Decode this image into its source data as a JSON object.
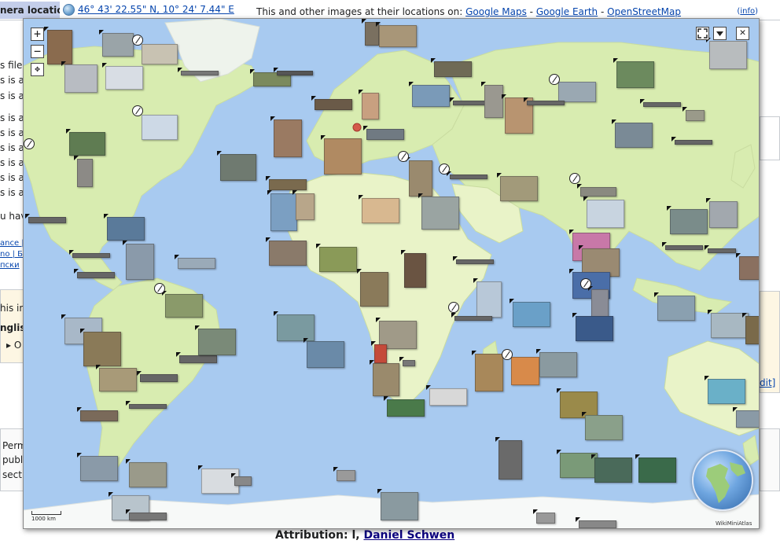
{
  "location_bar": {
    "label": "nera location",
    "coordinates": "46° 43' 22.55\" N, 10° 24' 7.44\" E",
    "text": "This and other images at their locations on:",
    "google_maps": "Google Maps",
    "google_earth": "Google Earth",
    "openstreetmap": "OpenStreetMap",
    "sep": "-",
    "info": "info"
  },
  "background": {
    "lines": [
      "s file w",
      "s is a",
      "s is a",
      "s is a",
      "s is a",
      "s is a",
      "s is a",
      "s is a",
      "s is a",
      "u hav"
    ],
    "links": [
      "ance | Б",
      "no | Б",
      "пски"
    ],
    "this_in": "his in",
    "english": "nglis",
    "o_item": "O",
    "perm_lines": [
      "Perm",
      "publi",
      "sect"
    ],
    "edit": "dit]"
  },
  "map": {
    "zoom_in": "+",
    "zoom_out": "−",
    "pan": "✥",
    "fullscreen_icon": "fullscreen-icon",
    "menu_icon": "dropdown-icon",
    "close": "✕",
    "scale_label": "1000 km",
    "minimap_label": "WikiMiniAtlas",
    "colors": {
      "ocean": "#a8caf0",
      "land": "#d8ecb0",
      "land_alt": "#e9f3c8",
      "ice": "#f7f9f8",
      "accent": "#d45a4a"
    }
  },
  "attribution": {
    "prefix": "Attribution: l,",
    "author": "Daniel Schwen"
  }
}
